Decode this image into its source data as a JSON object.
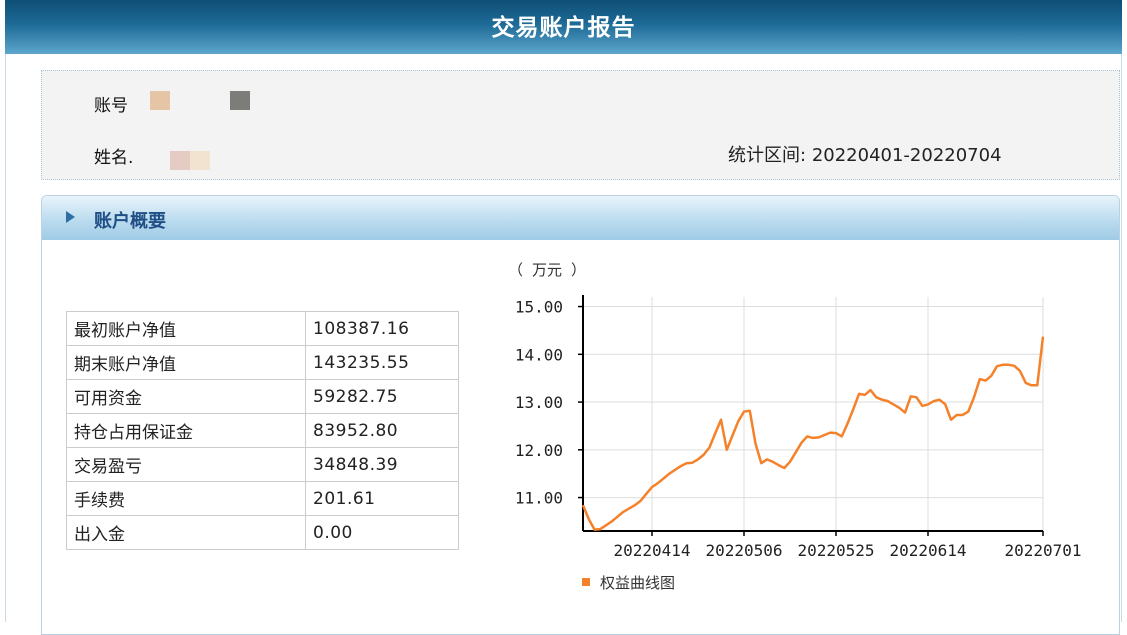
{
  "report": {
    "title": "交易账户报告",
    "account_label": "账号",
    "name_label": "姓名.",
    "period_label": "统计区间:",
    "period_value": "20220401-20220704"
  },
  "section": {
    "title": "账户概要"
  },
  "summary": [
    {
      "label": "最初账户净值",
      "value": "108387.16"
    },
    {
      "label": "期末账户净值",
      "value": "143235.55"
    },
    {
      "label": "可用资金",
      "value": "59282.75"
    },
    {
      "label": "持仓占用保证金",
      "value": "83952.80"
    },
    {
      "label": "交易盈亏",
      "value": "34848.39"
    },
    {
      "label": "手续费",
      "value": "201.61"
    },
    {
      "label": "出入金",
      "value": "0.00"
    }
  ],
  "colors": {
    "line": "#f5822a",
    "header": "#1d6b97",
    "section_title": "#1f4f86"
  },
  "chart_data": {
    "type": "line",
    "unit_label": "（ 万元 ）",
    "x_tick_labels": [
      "20220414",
      "20220506",
      "20220525",
      "20220614",
      "20220701"
    ],
    "y_tick_labels": [
      "11.00",
      "12.00",
      "13.00",
      "14.00",
      "15.00"
    ],
    "ylim": [
      10.3,
      15.2
    ],
    "grid": true,
    "legend": {
      "position": "bottom",
      "label": "权益曲线图"
    },
    "series": [
      {
        "name": "权益曲线图",
        "values": [
          10.84,
          10.55,
          10.33,
          10.34,
          10.42,
          10.5,
          10.6,
          10.7,
          10.77,
          10.84,
          10.93,
          11.08,
          11.22,
          11.3,
          11.4,
          11.5,
          11.58,
          11.66,
          11.72,
          11.73,
          11.8,
          11.9,
          12.05,
          12.35,
          12.63,
          12.0,
          12.3,
          12.6,
          12.8,
          12.82,
          12.13,
          11.72,
          11.8,
          11.75,
          11.68,
          11.62,
          11.75,
          11.95,
          12.15,
          12.28,
          12.25,
          12.26,
          12.31,
          12.36,
          12.35,
          12.28,
          12.55,
          12.85,
          13.17,
          13.15,
          13.25,
          13.1,
          13.05,
          13.02,
          12.95,
          12.88,
          12.78,
          13.12,
          13.1,
          12.92,
          12.95,
          13.02,
          13.05,
          12.95,
          12.63,
          12.73,
          12.73,
          12.8,
          13.1,
          13.48,
          13.45,
          13.55,
          13.75,
          13.78,
          13.78,
          13.76,
          13.65,
          13.4,
          13.35,
          13.35,
          14.37
        ]
      }
    ]
  }
}
